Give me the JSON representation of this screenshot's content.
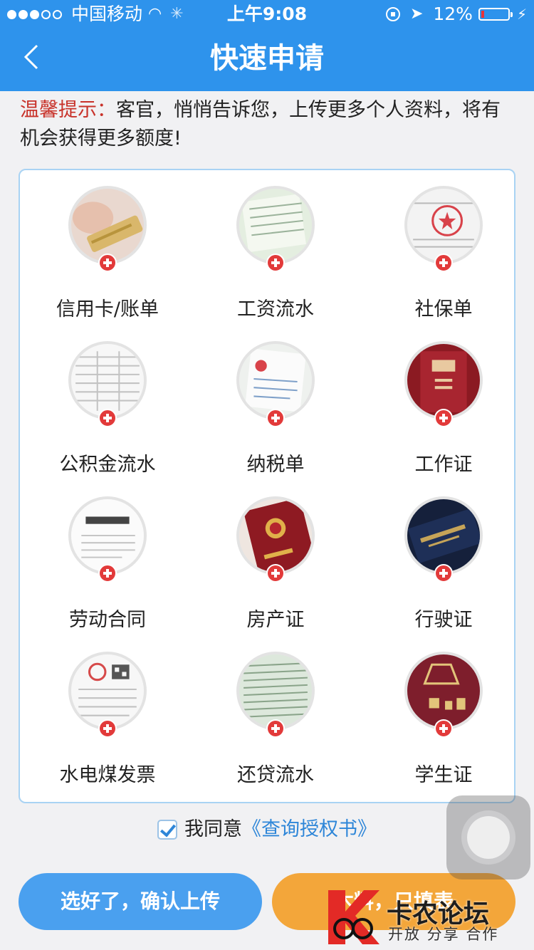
{
  "status_bar": {
    "carrier": "中国移动",
    "time": "上午9:08",
    "battery_percent": "12%",
    "battery_level": 0.12,
    "signal_bars": 3
  },
  "header": {
    "title": "快速申请",
    "background_color": "#2e93ec"
  },
  "tip": {
    "label": "温馨提示：",
    "text": "客官，悄悄告诉您，上传更多个人资料，将有机会获得更多额度!"
  },
  "documents": [
    {
      "label": "信用卡/账单",
      "icon": "credit-card-photo"
    },
    {
      "label": "工资流水",
      "icon": "salary-statement-photo"
    },
    {
      "label": "社保单",
      "icon": "social-security-photo"
    },
    {
      "label": "公积金流水",
      "icon": "housing-fund-photo"
    },
    {
      "label": "纳税单",
      "icon": "tax-receipt-photo"
    },
    {
      "label": "工作证",
      "icon": "work-id-photo"
    },
    {
      "label": "劳动合同",
      "icon": "labor-contract-photo"
    },
    {
      "label": "房产证",
      "icon": "property-cert-photo"
    },
    {
      "label": "行驶证",
      "icon": "vehicle-license-photo"
    },
    {
      "label": "水电煤发票",
      "icon": "utility-bill-photo"
    },
    {
      "label": "还贷流水",
      "icon": "loan-statement-photo"
    },
    {
      "label": "学生证",
      "icon": "student-id-photo"
    }
  ],
  "agreement": {
    "checked": true,
    "text": "我同意",
    "link": "《查询授权书》"
  },
  "buttons": {
    "confirm": "选好了，确认上传",
    "later": "木料，只填表"
  },
  "watermark": {
    "title": "卡农论坛",
    "subtitle": "开放 分享 合作"
  },
  "colors": {
    "accent_blue": "#2e93ec",
    "confirm_button": "#4aa0ef",
    "later_button": "#f3a63a",
    "tip_label": "#c8322a",
    "plus_badge": "#e23a3a"
  }
}
